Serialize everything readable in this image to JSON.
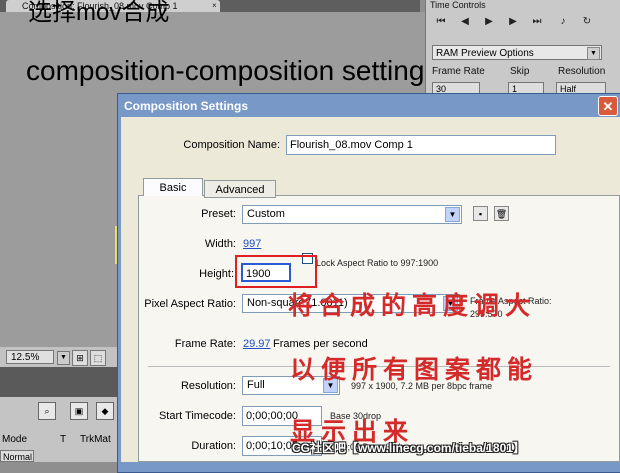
{
  "background": {
    "comp_tab": "Composition: Flourish_08.mov Comp 1",
    "comp_tab_close": "×",
    "time_controls_title": "Time Controls",
    "ram_preview": "RAM Preview Options",
    "frame_rate_label": "Frame Rate",
    "skip_label": "Skip",
    "resolution_label": "Resolution",
    "frame_rate_value": "30",
    "skip_value": "1",
    "resolution_value": "Half",
    "zoom": "12.5%",
    "timeline_headers": {
      "mode": "Mode",
      "t": "T",
      "trkmat": "TrkMat"
    },
    "mode_value": "Normal"
  },
  "overlay": {
    "title_cn": "选择mov合成",
    "title_en": "composition-composition setting",
    "note_line1": "将合成的高度调大",
    "note_line2": "以便所有图案都能",
    "note_line3": "显示出来",
    "watermark": "CG社区吧【www.linecg.com/tieba/1801】"
  },
  "dialog": {
    "title": "Composition Settings",
    "close": "✕",
    "comp_name_label": "Composition Name:",
    "comp_name_value": "Flourish_08.mov Comp 1",
    "tabs": {
      "basic": "Basic",
      "advanced": "Advanced"
    },
    "preset_label": "Preset:",
    "preset_value": "Custom",
    "width_label": "Width:",
    "width_value": "997",
    "height_label": "Height:",
    "height_value": "1900",
    "lock_label": "Lock Aspect Ratio to 997:1900",
    "par_label": "Pixel Aspect Ratio:",
    "par_value": "Non-square (1.0011)",
    "frame_aspect_label": "Frame Aspect Ratio:",
    "frame_aspect_value": "299:570",
    "frame_rate_label": "Frame Rate:",
    "frame_rate_value": "29.97",
    "frame_rate_unit": "Frames per second",
    "resolution_label": "Resolution:",
    "resolution_value": "Full",
    "resolution_note": "997 x 1900, 7.2 MB per 8bpc frame",
    "start_tc_label": "Start Timecode:",
    "start_tc_value": "0;00;00;00",
    "start_tc_note": "Base 30drop",
    "duration_label": "Duration:",
    "duration_value": "0;00;10;05",
    "duration_note": "0;10;05 Base 30drop"
  }
}
